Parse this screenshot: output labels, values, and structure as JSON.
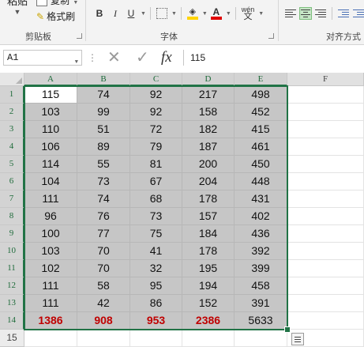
{
  "ribbon": {
    "paste_label": "粘贴",
    "copy_label": "复制",
    "format_painter_label": "格式刷",
    "clipboard_group": "剪贴板",
    "font_group": "字体",
    "align_group": "对齐方式",
    "bold": "B",
    "italic": "I",
    "underline": "U",
    "font_color_glyph": "A",
    "pinyin_top": "wén",
    "pinyin_bottom": "文"
  },
  "formula_bar": {
    "name_box": "A1",
    "formula": "115"
  },
  "columns": [
    "A",
    "B",
    "C",
    "D",
    "E",
    "F"
  ],
  "rows": [
    {
      "num": "1",
      "cells": [
        "115",
        "74",
        "92",
        "217",
        "498"
      ]
    },
    {
      "num": "2",
      "cells": [
        "103",
        "99",
        "92",
        "158",
        "452"
      ]
    },
    {
      "num": "3",
      "cells": [
        "110",
        "51",
        "72",
        "182",
        "415"
      ]
    },
    {
      "num": "4",
      "cells": [
        "106",
        "89",
        "79",
        "187",
        "461"
      ]
    },
    {
      "num": "5",
      "cells": [
        "114",
        "55",
        "81",
        "200",
        "450"
      ]
    },
    {
      "num": "6",
      "cells": [
        "104",
        "73",
        "67",
        "204",
        "448"
      ]
    },
    {
      "num": "7",
      "cells": [
        "111",
        "74",
        "68",
        "178",
        "431"
      ]
    },
    {
      "num": "8",
      "cells": [
        "96",
        "76",
        "73",
        "157",
        "402"
      ]
    },
    {
      "num": "9",
      "cells": [
        "100",
        "77",
        "75",
        "184",
        "436"
      ]
    },
    {
      "num": "10",
      "cells": [
        "103",
        "70",
        "41",
        "178",
        "392"
      ]
    },
    {
      "num": "11",
      "cells": [
        "102",
        "70",
        "32",
        "195",
        "399"
      ]
    },
    {
      "num": "12",
      "cells": [
        "111",
        "58",
        "95",
        "194",
        "458"
      ]
    },
    {
      "num": "13",
      "cells": [
        "111",
        "42",
        "86",
        "152",
        "391"
      ]
    },
    {
      "num": "14",
      "cells": [
        "1386",
        "908",
        "953",
        "2386",
        "5633"
      ]
    },
    {
      "num": "15",
      "cells": [
        "",
        "",
        "",
        "",
        ""
      ]
    }
  ],
  "colors": {
    "selection": "#217346",
    "sum_text": "#c00000",
    "selection_fill": "#c6c6c6"
  },
  "icons": {
    "paste": "paste-icon",
    "copy": "copy-icon",
    "format_painter": "brush-icon",
    "borders": "borders-icon",
    "fill_color": "fill-color-icon",
    "font_color": "font-color-icon",
    "cancel": "x-icon",
    "enter": "check-icon",
    "function": "fx-icon",
    "quick_analysis": "quick-analysis-icon"
  }
}
